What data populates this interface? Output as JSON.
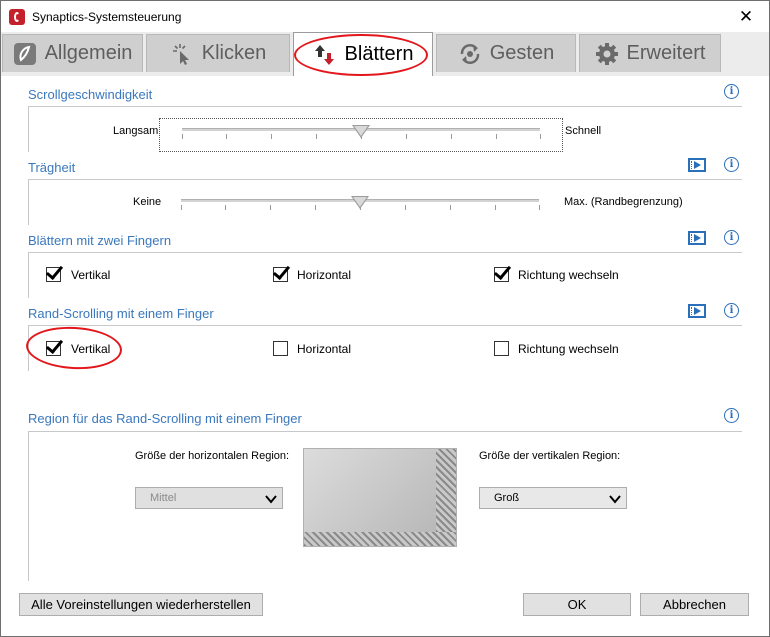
{
  "window": {
    "title": "Synaptics-Systemsteuerung",
    "close_glyph": "✕"
  },
  "tabs": [
    {
      "label": "Allgemein",
      "icon": "synaptics-leaf-icon"
    },
    {
      "label": "Klicken",
      "icon": "cursor-click-icon"
    },
    {
      "label": "Blättern",
      "icon": "scroll-arrows-icon",
      "active": true
    },
    {
      "label": "Gesten",
      "icon": "gesture-cycle-icon"
    },
    {
      "label": "Erweitert",
      "icon": "gear-icon"
    }
  ],
  "sections": {
    "scroll_speed": {
      "title": "Scrollgeschwindigkeit",
      "left_label": "Langsam",
      "right_label": "Schnell",
      "value": 0.5
    },
    "inertia": {
      "title": "Trägheit",
      "left_label": "Keine",
      "right_label": "Max. (Randbegrenzung)",
      "value": 0.5
    },
    "two_finger": {
      "title": "Blättern mit zwei Fingern",
      "options": [
        {
          "label": "Vertikal",
          "checked": true
        },
        {
          "label": "Horizontal",
          "checked": true
        },
        {
          "label": "Richtung wechseln",
          "checked": true
        }
      ]
    },
    "edge_scroll": {
      "title": "Rand-Scrolling mit einem Finger",
      "options": [
        {
          "label": "Vertikal",
          "checked": true
        },
        {
          "label": "Horizontal",
          "checked": false
        },
        {
          "label": "Richtung wechseln",
          "checked": false
        }
      ]
    },
    "region": {
      "title": "Region für das Rand-Scrolling mit einem Finger",
      "horizontal_label": "Größe der horizontalen Region:",
      "horizontal_value": "Mittel",
      "vertical_label": "Größe der vertikalen Region:",
      "vertical_value": "Groß"
    }
  },
  "buttons": {
    "restore": "Alle Voreinstellungen wiederherstellen",
    "ok": "OK",
    "cancel": "Abbrechen"
  },
  "colors": {
    "accent": "#3a78bd",
    "annotation": "#e3161b",
    "scroll_icon": "#c4202b"
  }
}
